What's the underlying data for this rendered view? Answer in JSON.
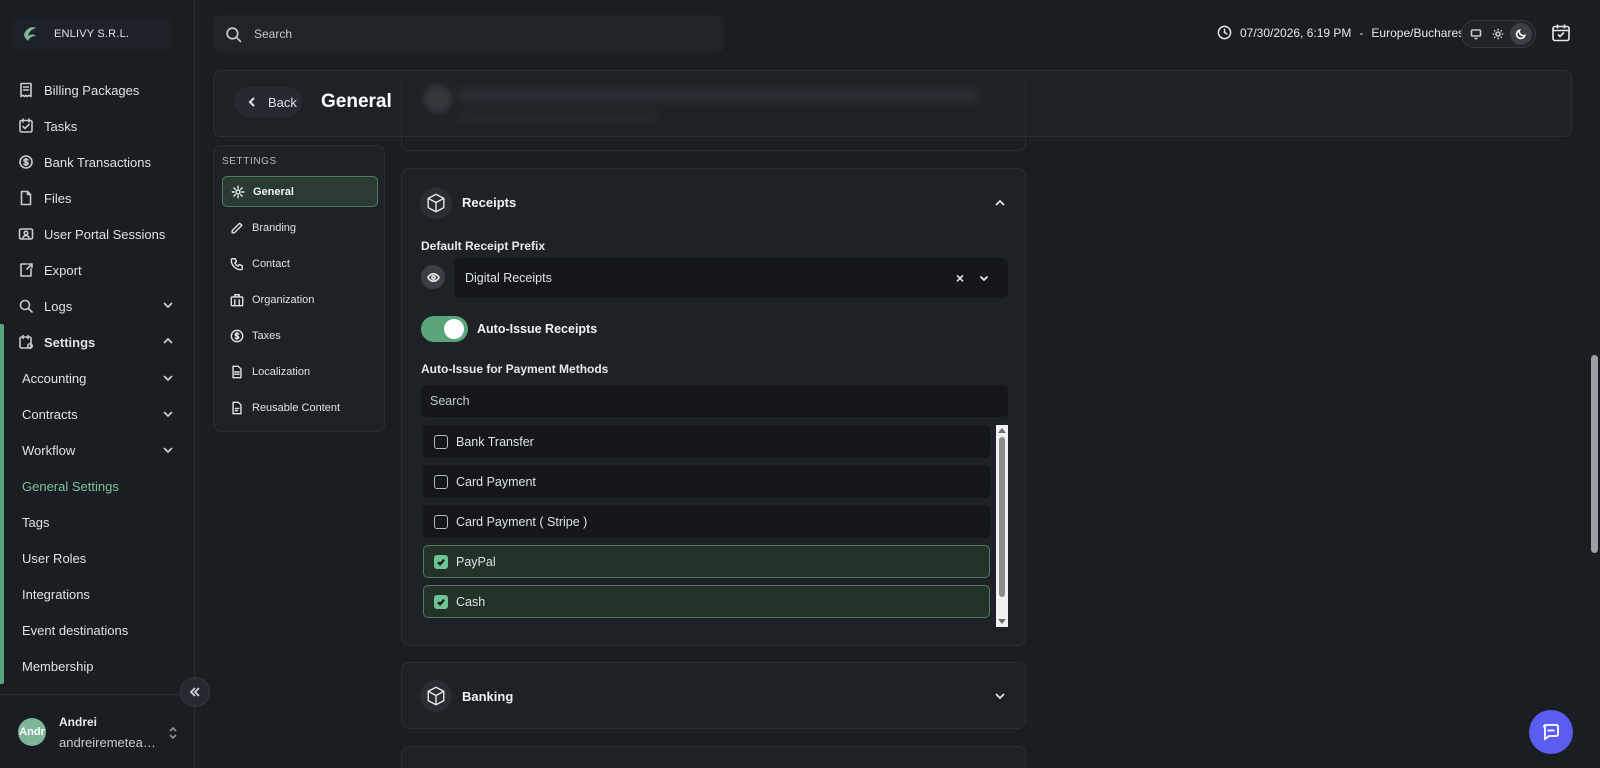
{
  "brand": {
    "name": "ENLIVY S.R.L."
  },
  "sidebar": {
    "items": [
      {
        "label": "Billing Packages",
        "icon": "receipt-icon"
      },
      {
        "label": "Tasks",
        "icon": "tasks-icon"
      },
      {
        "label": "Bank Transactions",
        "icon": "bank-icon"
      },
      {
        "label": "Files",
        "icon": "file-icon"
      },
      {
        "label": "User Portal Sessions",
        "icon": "user-portal-icon"
      },
      {
        "label": "Export",
        "icon": "export-icon"
      },
      {
        "label": "Logs",
        "icon": "logs-icon"
      },
      {
        "label": "Settings",
        "icon": "settings-icon"
      }
    ],
    "settings_sub": [
      {
        "label": "Accounting"
      },
      {
        "label": "Contracts"
      },
      {
        "label": "Workflow"
      },
      {
        "label": "General Settings"
      },
      {
        "label": "Tags"
      },
      {
        "label": "User Roles"
      },
      {
        "label": "Integrations"
      },
      {
        "label": "Event destinations"
      },
      {
        "label": "Membership"
      }
    ]
  },
  "user": {
    "name": "Andrei",
    "email": "andreiremetean...",
    "avatar_initials": "Andr"
  },
  "topbar": {
    "search_placeholder": "Search",
    "datetime": "07/30/2026, 6:19 PM",
    "separator": "-",
    "timezone": "Europe/Bucharest"
  },
  "header": {
    "back_label": "Back",
    "title": "General"
  },
  "settings_menu": {
    "heading": "SETTINGS",
    "items": [
      {
        "label": "General",
        "icon": "gear-icon"
      },
      {
        "label": "Branding",
        "icon": "pen-icon"
      },
      {
        "label": "Contact",
        "icon": "phone-icon"
      },
      {
        "label": "Organization",
        "icon": "building-icon"
      },
      {
        "label": "Taxes",
        "icon": "dollar-icon"
      },
      {
        "label": "Localization",
        "icon": "document-icon"
      },
      {
        "label": "Reusable Content",
        "icon": "document-copy-icon"
      }
    ]
  },
  "receipts": {
    "title": "Receipts",
    "prefix_label": "Default Receipt Prefix",
    "prefix_value": "Digital Receipts",
    "clear_glyph": "×",
    "auto_issue_label": "Auto-Issue Receipts",
    "auto_issue_on": true,
    "pm_label": "Auto-Issue for Payment Methods",
    "pm_search_placeholder": "Search",
    "payment_methods": [
      {
        "label": "Bank Transfer",
        "checked": false
      },
      {
        "label": "Card Payment",
        "checked": false
      },
      {
        "label": "Card Payment ( Stripe )",
        "checked": false
      },
      {
        "label": "PayPal",
        "checked": true
      },
      {
        "label": "Cash",
        "checked": true
      }
    ]
  },
  "banking": {
    "title": "Banking"
  },
  "colors": {
    "accent": "#5aa67a",
    "chat": "#5b5cf0",
    "background": "#1a1d22"
  }
}
